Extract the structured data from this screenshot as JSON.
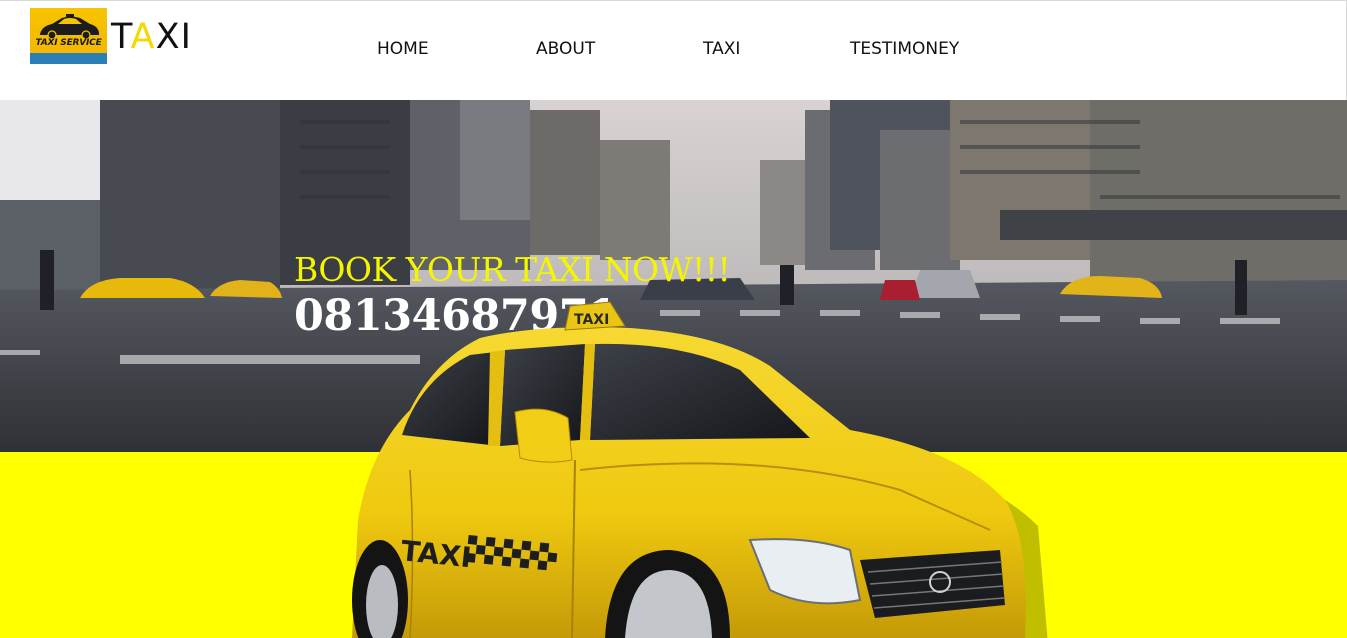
{
  "header": {
    "logo": {
      "badge_text": "TAXI SERVICE",
      "badge_subtext": "",
      "brand_prefix": "T",
      "brand_accent": "A",
      "brand_suffix": "XI"
    },
    "nav": [
      {
        "label": "HOME"
      },
      {
        "label": "ABOUT"
      },
      {
        "label": "TAXI"
      },
      {
        "label": "TESTIMONEY"
      }
    ]
  },
  "hero": {
    "headline": "BOOK YOUR TAXI NOW!!!",
    "phone": "08134687971",
    "taxi_roof_sign": "TAXI",
    "taxi_door_text": "TAXI"
  },
  "colors": {
    "accent_yellow": "#ffff00",
    "headline_yellow": "#f5f500",
    "brand_accent": "#f5d800",
    "taxi_body": "#f2cf16"
  }
}
